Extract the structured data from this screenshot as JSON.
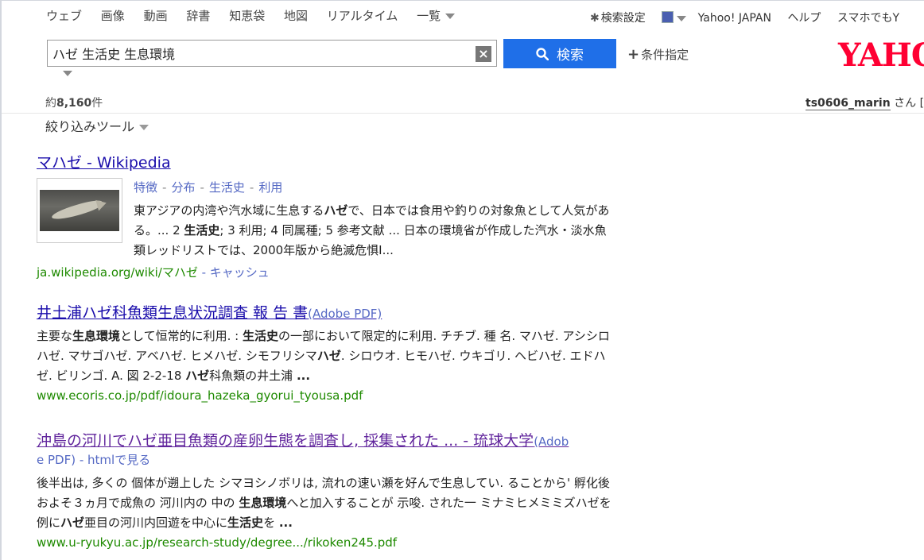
{
  "nav": {
    "tabs": [
      "ウェブ",
      "画像",
      "動画",
      "辞書",
      "知恵袋",
      "地図",
      "リアルタイム"
    ],
    "more": "一覧"
  },
  "rightnav": {
    "settings": "検索設定",
    "yahoo_japan": "Yahoo! JAPAN",
    "help": "ヘルプ",
    "smartphone": "スマホでもY"
  },
  "search": {
    "query": "ハゼ 生活史 生息環境",
    "clear": "×",
    "button": "検索",
    "conditions": "条件指定"
  },
  "logo": "YAHOO",
  "count": {
    "prefix": "約",
    "number": "8,160",
    "suffix": "件"
  },
  "user": {
    "name": "ts0606_marin",
    "suffix": "さん [ ロ"
  },
  "tools": "絞り込みツール",
  "results": [
    {
      "title": "マハゼ - Wikipedia",
      "sublinks": [
        "特徴",
        "分布",
        "生活史",
        "利用"
      ],
      "snippet_html": "東アジアの内湾や汽水域に生息する<b>ハゼ</b>で、日本では食用や釣りの対象魚として人気がある。... 2 <b>生活史</b>; 3 利用; 4 同属種; 5 参考文献 ... 日本の環境省が作成した汽水・淡水魚類レッドリストでは、2000年版から絶滅危惧I...",
      "url": "ja.wikipedia.org/wiki/マハゼ",
      "cache": "キャッシュ"
    },
    {
      "title": "井土浦ハゼ科魚類生息状況調査 報 告 書",
      "tag": "(Adobe PDF)",
      "snippet_html": "主要な<b>生息環境</b>として恒常的に利用. : <b>生活史</b>の一部において限定的に利用. チチブ. 種 名. マハゼ. アシシロハゼ. マサゴハゼ. アベハゼ. ヒメハゼ. シモフリシマ<b>ハゼ</b>. シロウオ. ヒモハゼ. ウキゴリ. ヘビハゼ. エドハゼ. ビリンゴ. A. 図 2-2-18 <b>ハゼ</b>科魚類の井土浦 <b>...</b>",
      "url": "www.ecoris.co.jp/pdf/idoura_hazeka_gyorui_tyousa.pdf"
    },
    {
      "title": "沖島の河川でハゼ亜目魚類の産卵生態を調査し, 採集された ... - 琉球大学",
      "tag_a": "(Adob",
      "tag_b": "e PDF) - htmlで見る",
      "snippet_html": "後半出は, 多くの 個体が遡上した シマヨシノボリは, 流れの速い瀬を好んで生息してい. ることから' 孵化後およそ３ヵ月で成魚の 河川内の 中の <b>生息環境</b>へと加入することが 示唆. された一 ミナミヒメミミズハゼを例に<b>ハゼ</b>亜目の河川内回遊を中心に<b>生活史</b>を <b>...</b>",
      "url": "www.u-ryukyu.ac.jp/research-study/degree.../rikoken245.pdf"
    }
  ]
}
